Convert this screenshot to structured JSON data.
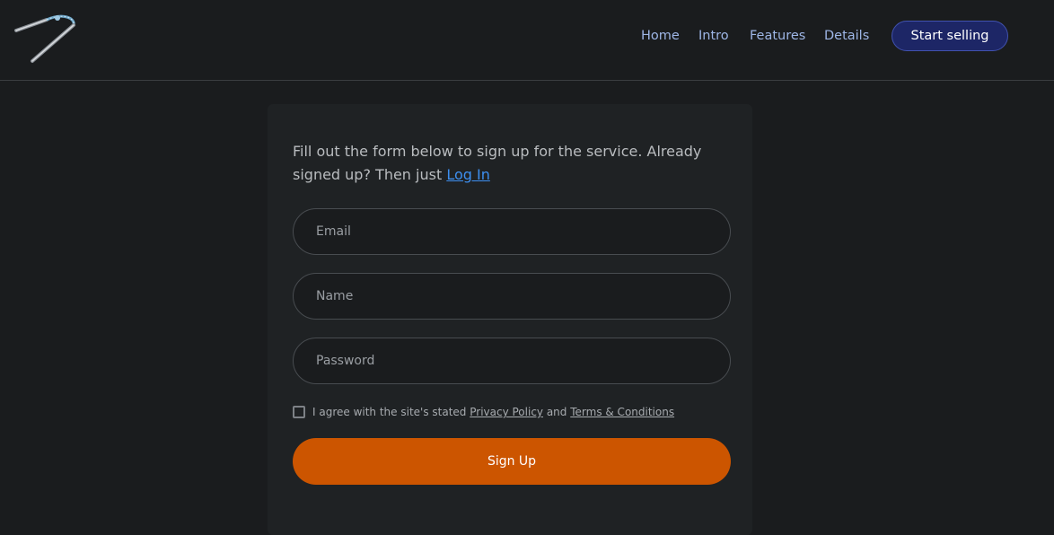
{
  "nav": {
    "logo_icon": "jumper-cable-logo-icon",
    "links": [
      "Home",
      "Intro",
      "Features",
      "Details"
    ],
    "cta_label": "Start selling"
  },
  "form": {
    "intro_text": "Fill out the form below to sign up for the service. Already signed up? Then just ",
    "login_link": "Log In",
    "email_placeholder": "Email",
    "name_placeholder": "Name",
    "password_placeholder": "Password",
    "agree_prefix": "I agree with the site's stated ",
    "privacy_link": "Privacy Policy",
    "agree_and": " and ",
    "terms_link": "Terms & Conditions",
    "submit_label": "Sign Up"
  },
  "colors": {
    "background": "#1a1c1e",
    "card": "#1f2224",
    "accent": "#cc5500",
    "cta": "#1d2666",
    "link": "#3d8ff0"
  }
}
